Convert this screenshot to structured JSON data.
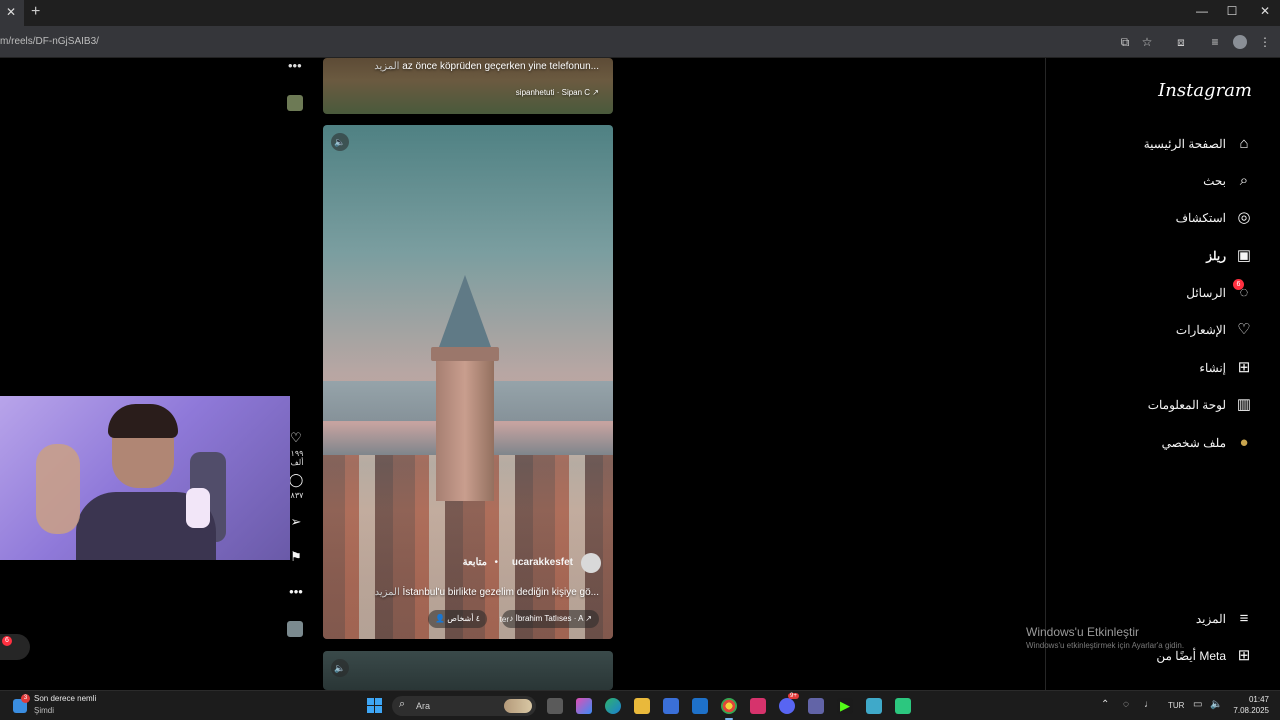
{
  "browser": {
    "url": "m/reels/DF-nGjSAIB3/",
    "tab_close": "✕",
    "new_tab": "+"
  },
  "instagram": {
    "logo": "Instagram",
    "nav": [
      {
        "label": "الصفحة الرئيسية",
        "icon": "home-icon",
        "glyph": "⌂"
      },
      {
        "label": "بحث",
        "icon": "search-icon",
        "glyph": "⌕"
      },
      {
        "label": "استكشاف",
        "icon": "compass-icon",
        "glyph": "◎"
      },
      {
        "label": "ريلز",
        "icon": "reels-icon",
        "glyph": "▣"
      },
      {
        "label": "الرسائل",
        "icon": "messenger-icon",
        "glyph": "◌",
        "badge": "6"
      },
      {
        "label": "الإشعارات",
        "icon": "heart-icon",
        "glyph": "♡"
      },
      {
        "label": "إنشاء",
        "icon": "create-icon",
        "glyph": "⊞"
      },
      {
        "label": "لوحة المعلومات",
        "icon": "dashboard-icon",
        "glyph": "▥"
      },
      {
        "label": "ملف شخصي",
        "icon": "profile-avatar-icon",
        "glyph": "●"
      }
    ],
    "more": {
      "label": "المزيد",
      "glyph": "≡"
    },
    "meta": {
      "label": "أيضًا من Meta",
      "glyph": "⊞"
    }
  },
  "reels": {
    "top": {
      "caption": "az önce köprüden geçerken yine telefonun...",
      "more": "المزيد",
      "audio": "sipanhetuti · Sipan C ↗"
    },
    "main": {
      "username": "ucarakkesfet",
      "follow": "متابعة",
      "caption": "İstanbul'u birlikte gezelim dediğin kişiye gö...",
      "more": "المزيد",
      "people": "٤ أشخاص",
      "audio_left": "ter",
      "audio": "İbrahim Tatlıses · A ↗",
      "likes": "١٩٩ ألف",
      "comments": "٨٣٧"
    }
  },
  "left": {
    "badge": "6"
  },
  "windows": {
    "activation_title": "Windows'u Etkinleştir",
    "activation_sub": "Windows'u etkinleştirmek için Ayarlar'a gidin."
  },
  "taskbar": {
    "notif_title": "Son derece nemli",
    "notif_sub": "Şimdi",
    "notif_badge": "3",
    "search": "Ara",
    "lang": "TUR",
    "time": "01:47",
    "date": "7.08.2025",
    "discord_badge": "9+"
  }
}
